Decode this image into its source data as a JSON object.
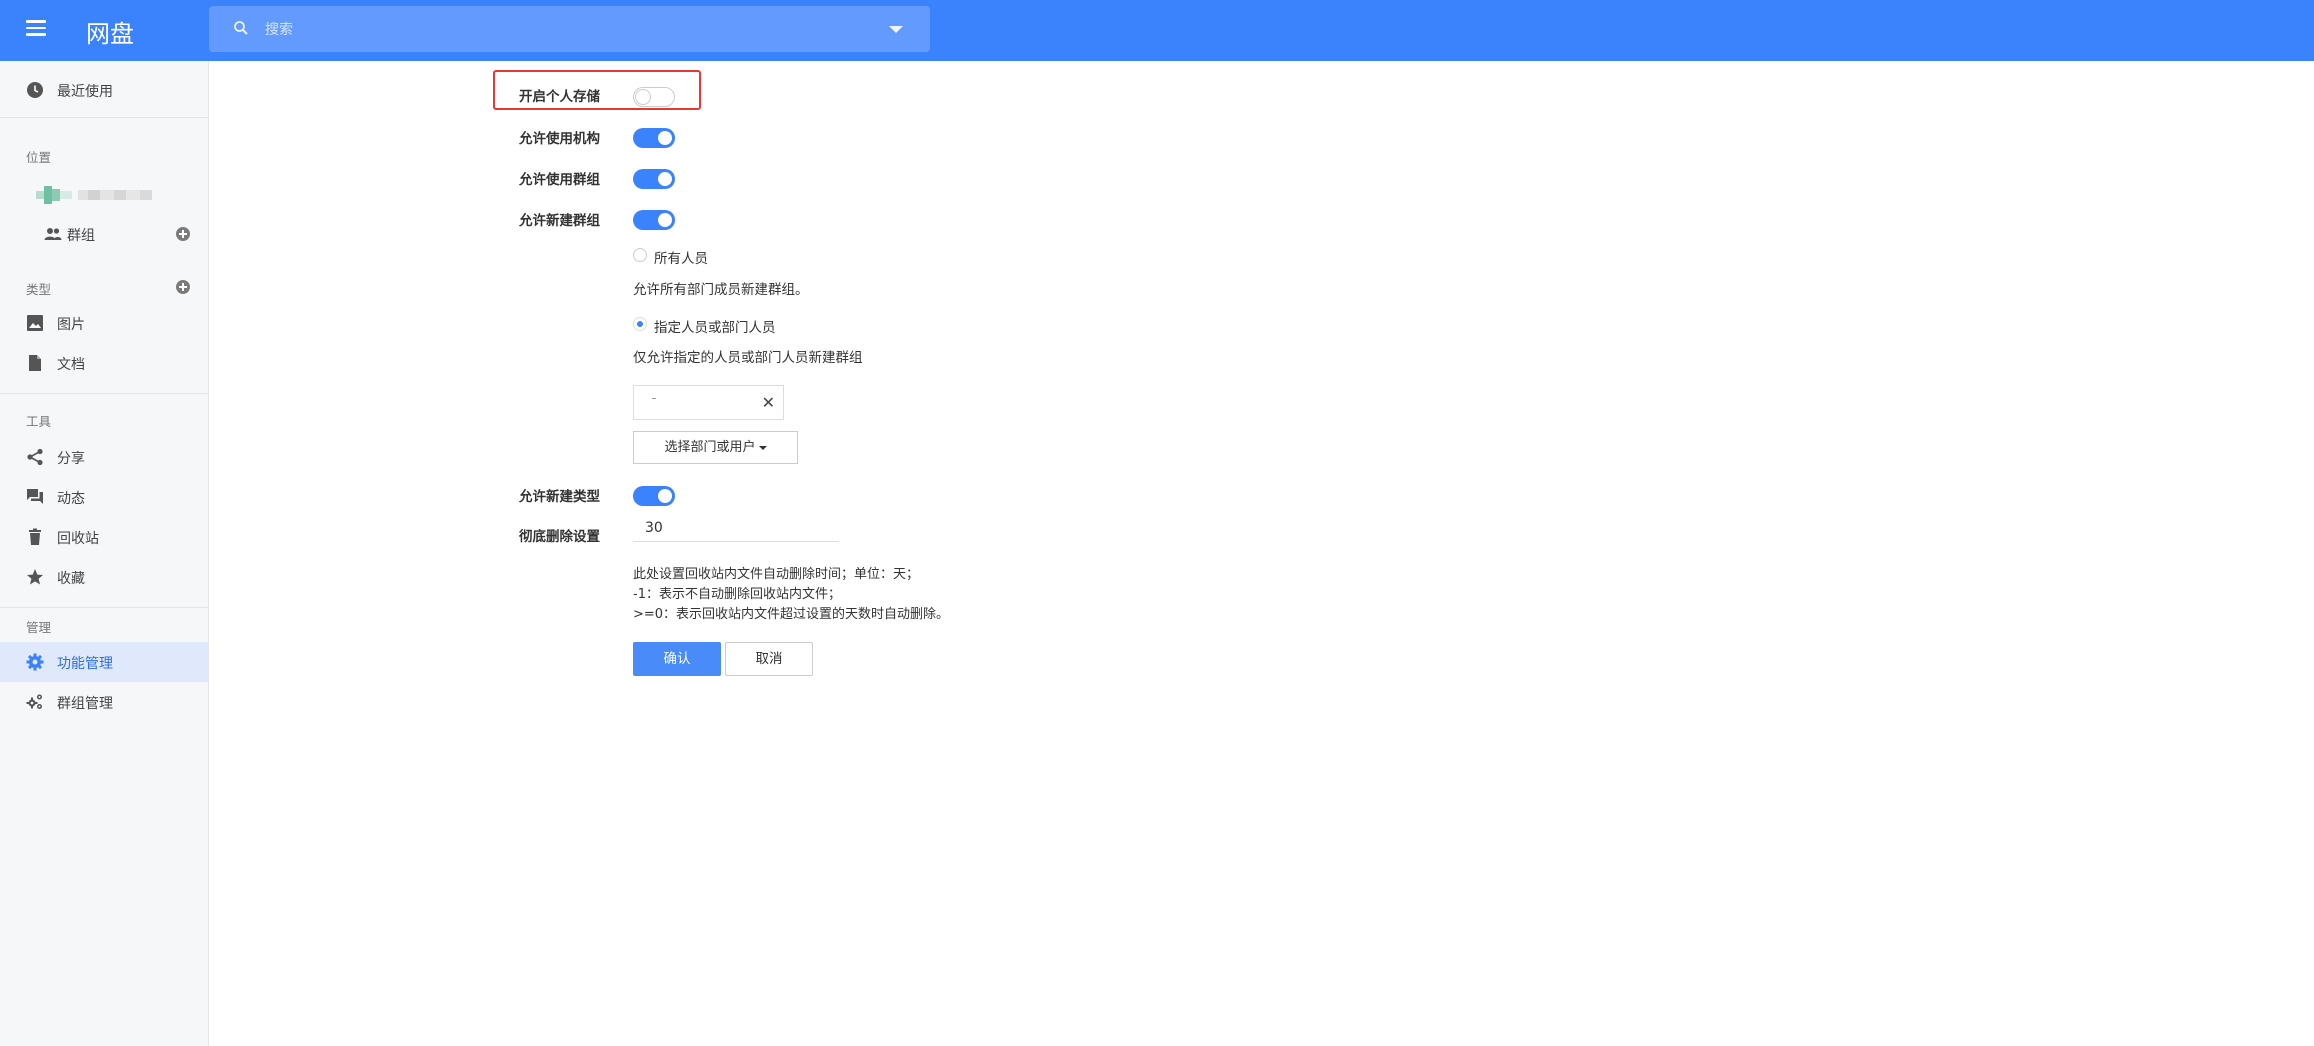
{
  "header": {
    "app_title": "网盘",
    "search_placeholder": "搜索",
    "accent_color": "#3b82fd"
  },
  "sidebar": {
    "recent_label": "最近使用",
    "location_section": "位置",
    "groups_label": "群组",
    "type_section": "类型",
    "images_label": "图片",
    "docs_label": "文档",
    "tools_section": "工具",
    "share_label": "分享",
    "activity_label": "动态",
    "recycle_label": "回收站",
    "favorites_label": "收藏",
    "manage_section": "管理",
    "feature_mgmt_label": "功能管理",
    "group_mgmt_label": "群组管理"
  },
  "settings": {
    "personal_storage_label": "开启个人存储",
    "personal_storage_on": false,
    "allow_org_label": "允许使用机构",
    "allow_org_on": true,
    "allow_groups_label": "允许使用群组",
    "allow_groups_on": true,
    "allow_new_group_label": "允许新建群组",
    "allow_new_group_on": true,
    "option_everyone": "所有人员",
    "option_everyone_desc": "允许所有部门成员新建群组。",
    "option_specified": "指定人员或部门人员",
    "option_specified_desc": "仅允许指定的人员或部门人员新建群组",
    "select_button": "选择部门或用户",
    "allow_new_type_label": "允许新建类型",
    "allow_new_type_on": true,
    "purge_label": "彻底删除设置",
    "purge_value": "30",
    "purge_help_1": "此处设置回收站内文件自动删除时间；单位：天；",
    "purge_help_2": "-1：表示不自动删除回收站内文件；",
    "purge_help_3": ">=0：表示回收站内文件超过设置的天数时自动删除。",
    "confirm_label": "确认",
    "cancel_label": "取消"
  }
}
